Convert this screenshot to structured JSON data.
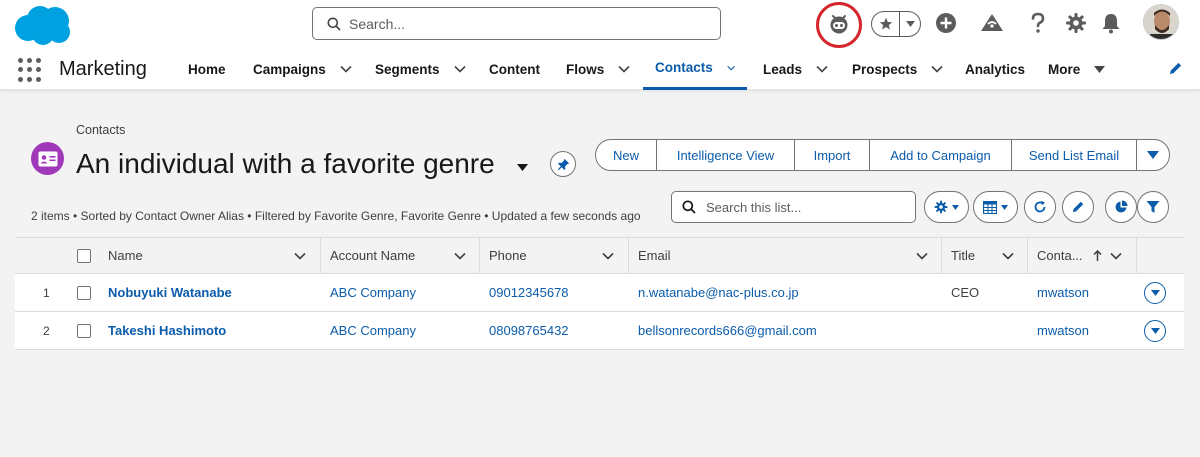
{
  "header": {
    "search_placeholder": "Search...",
    "icons": [
      "cloud-logo",
      "search-icon",
      "agent-icon",
      "star-icon",
      "add-icon",
      "setup-trailhead-icon",
      "help-icon",
      "settings-gear-icon",
      "bell-icon",
      "avatar"
    ]
  },
  "nav": {
    "app_name": "Marketing",
    "items": [
      {
        "label": "Home",
        "has_menu": false,
        "active": false
      },
      {
        "label": "Campaigns",
        "has_menu": true,
        "active": false
      },
      {
        "label": "Segments",
        "has_menu": true,
        "active": false
      },
      {
        "label": "Content",
        "has_menu": false,
        "active": false
      },
      {
        "label": "Flows",
        "has_menu": true,
        "active": false
      },
      {
        "label": "Contacts",
        "has_menu": true,
        "active": true
      },
      {
        "label": "Leads",
        "has_menu": true,
        "active": false
      },
      {
        "label": "Prospects",
        "has_menu": true,
        "active": false
      },
      {
        "label": "Analytics",
        "has_menu": false,
        "active": false
      },
      {
        "label": "More",
        "has_menu": true,
        "active": false
      }
    ]
  },
  "list_view": {
    "breadcrumb": "Contacts",
    "title": "An individual with a favorite genre",
    "actions": [
      "New",
      "Intelligence View",
      "Import",
      "Add to Campaign",
      "Send List Email"
    ],
    "status_line": "2 items • Sorted by Contact Owner Alias • Filtered by Favorite Genre, Favorite Genre • Updated a few seconds ago",
    "search_placeholder": "Search this list..."
  },
  "table": {
    "columns": [
      "Name",
      "Account Name",
      "Phone",
      "Email",
      "Title",
      "Conta..."
    ],
    "rows": [
      {
        "num": "1",
        "name": "Nobuyuki Watanabe",
        "account": "ABC Company",
        "phone": "09012345678",
        "email": "n.watanabe@nac-plus.co.jp",
        "title": "CEO",
        "owner": "mwatson"
      },
      {
        "num": "2",
        "name": "Takeshi Hashimoto",
        "account": "ABC Company",
        "phone": "08098765432",
        "email": "bellsonrecords666@gmail.com",
        "title": "",
        "owner": "mwatson"
      }
    ]
  },
  "colors": {
    "brand_blue": "#0b5cab",
    "salesforce_cloud": "#00a1e0",
    "contact_icon_purple": "#a039b9",
    "highlight_ring": "#d5262e"
  }
}
